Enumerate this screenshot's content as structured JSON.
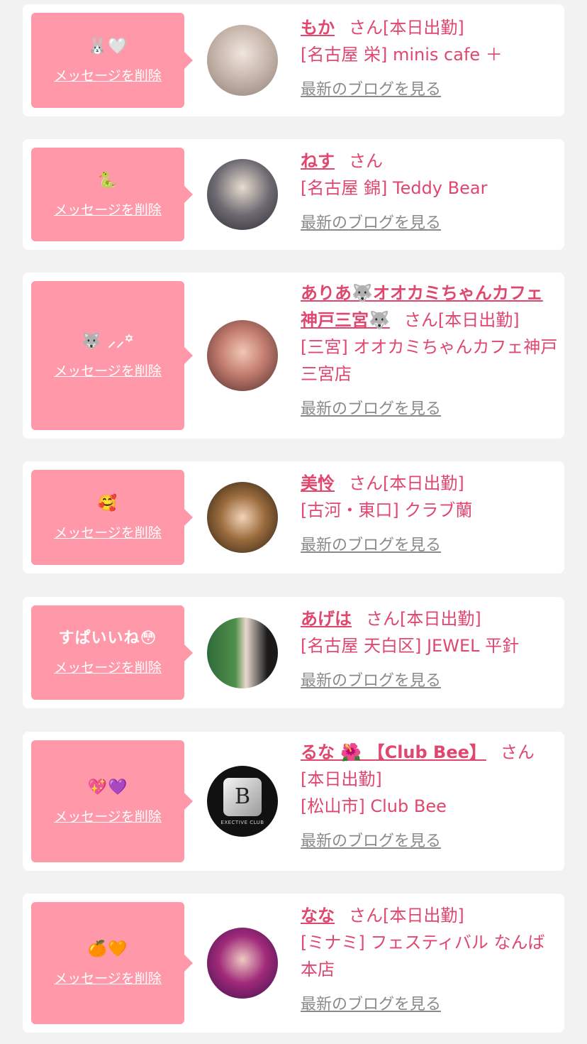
{
  "messages": [
    {
      "bubble_text": "🐰🤍",
      "delete_label": "メッセージを削除",
      "name": "もか",
      "honorific": "さん",
      "status": "[本日出勤]",
      "shop": "[名古屋 栄] minis cafe ＋",
      "blog_label": "最新のブログを見る"
    },
    {
      "bubble_text": "🐍",
      "delete_label": "メッセージを削除",
      "name": "ねす",
      "honorific": "さん",
      "status": "",
      "shop": "[名古屋 錦] Teddy Bear",
      "blog_label": "最新のブログを見る"
    },
    {
      "bubble_text": "🐺 ⸝⸝꙳",
      "delete_label": "メッセージを削除",
      "name": "ありあ🐺オオカミちゃんカフェ神戸三宮🐺",
      "honorific": "さん",
      "status": "[本日出勤]",
      "shop": "[三宮] オオカミちゃんカフェ神戸三宮店",
      "blog_label": "最新のブログを見る"
    },
    {
      "bubble_text": "🥰",
      "delete_label": "メッセージを削除",
      "name": "美怜",
      "honorific": "さん",
      "status": "[本日出勤]",
      "shop": "[古河・東口] クラブ蘭",
      "blog_label": "最新のブログを見る"
    },
    {
      "bubble_text": "すぱいいね😳",
      "delete_label": "メッセージを削除",
      "name": "あげは",
      "honorific": "さん",
      "status": "[本日出勤]",
      "shop": "[名古屋 天白区] JEWEL 平針",
      "blog_label": "最新のブログを見る"
    },
    {
      "bubble_text": "💖💜",
      "delete_label": "メッセージを削除",
      "name": "るな 🌺 【Club Bee】",
      "honorific": "さん",
      "status": "[本日出勤]",
      "shop": "[松山市] Club Bee",
      "blog_label": "最新のブログを見る",
      "logo_letter": "B",
      "logo_caption": "EXECTIVE CLUB"
    },
    {
      "bubble_text": "🍊🧡",
      "delete_label": "メッセージを削除",
      "name": "なな",
      "honorific": "さん",
      "status": "[本日出勤]",
      "shop": "[ミナミ] フェスティバル なんば本店",
      "blog_label": "最新のブログを見る"
    }
  ],
  "colors": {
    "page_bg": "#f2f2f2",
    "card_bg": "#ffffff",
    "bubble_bg": "#ff99aa",
    "accent": "#e0476e",
    "link_gray": "#8a8a8a"
  }
}
